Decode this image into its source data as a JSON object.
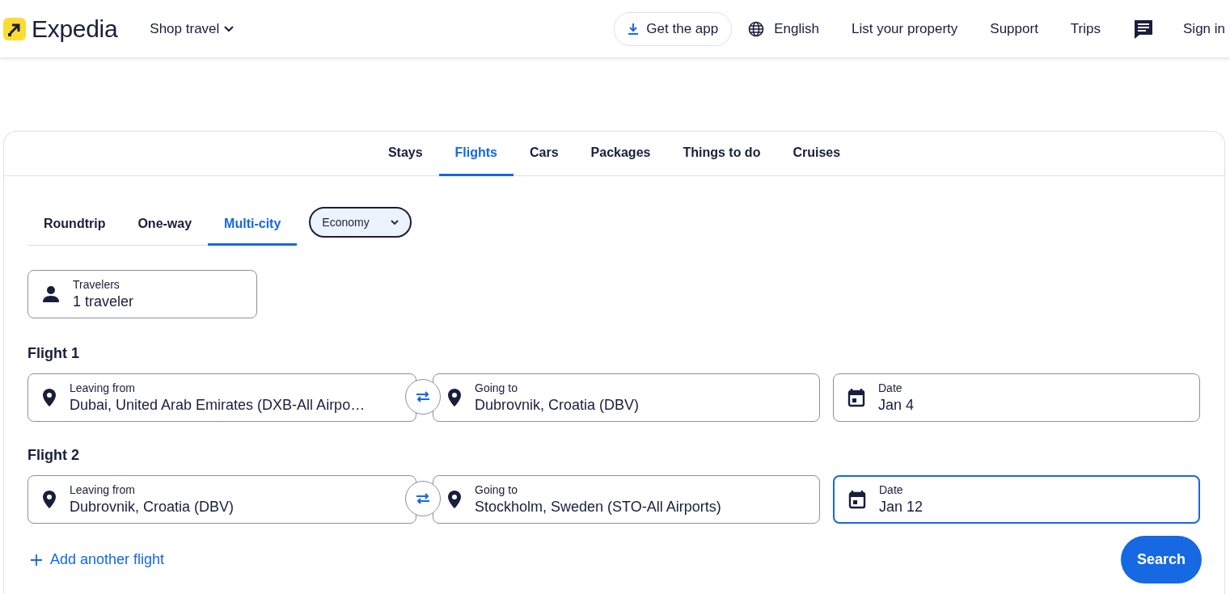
{
  "header": {
    "logo": "Expedia",
    "shop_travel": "Shop travel",
    "nav": [
      {
        "kind": "app",
        "label": "Get the app"
      },
      {
        "kind": "language",
        "label": "English"
      },
      {
        "kind": "text",
        "label": "List your property"
      },
      {
        "kind": "text",
        "label": "Support"
      },
      {
        "kind": "text",
        "label": "Trips"
      },
      {
        "kind": "messages"
      },
      {
        "kind": "text",
        "label": "Sign in"
      }
    ]
  },
  "tabs": [
    {
      "label": "Stays",
      "selected": false
    },
    {
      "label": "Flights",
      "selected": true
    },
    {
      "label": "Cars",
      "selected": false
    },
    {
      "label": "Packages",
      "selected": false
    },
    {
      "label": "Things to do",
      "selected": false
    },
    {
      "label": "Cruises",
      "selected": false
    }
  ],
  "trip_types": [
    {
      "label": "Roundtrip",
      "selected": false
    },
    {
      "label": "One-way",
      "selected": false
    },
    {
      "label": "Multi-city",
      "selected": true
    }
  ],
  "cabin_class": {
    "value": "Economy"
  },
  "travelers": {
    "label": "Travelers",
    "value": "1 traveler"
  },
  "flights": [
    {
      "title": "Flight 1",
      "leaving": {
        "label": "Leaving from",
        "value": "Dubai, United Arab Emirates (DXB-All Airpo…"
      },
      "going": {
        "label": "Going to",
        "value": "Dubrovnik, Croatia (DBV)"
      },
      "date": {
        "label": "Date",
        "value": "Jan 4",
        "focused": false
      }
    },
    {
      "title": "Flight 2",
      "leaving": {
        "label": "Leaving from",
        "value": "Dubrovnik, Croatia (DBV)"
      },
      "going": {
        "label": "Going to",
        "value": "Stockholm, Sweden (STO-All Airports)"
      },
      "date": {
        "label": "Date",
        "value": "Jan 12",
        "focused": true
      }
    }
  ],
  "add_flight": "Add another flight",
  "search_button": "Search"
}
